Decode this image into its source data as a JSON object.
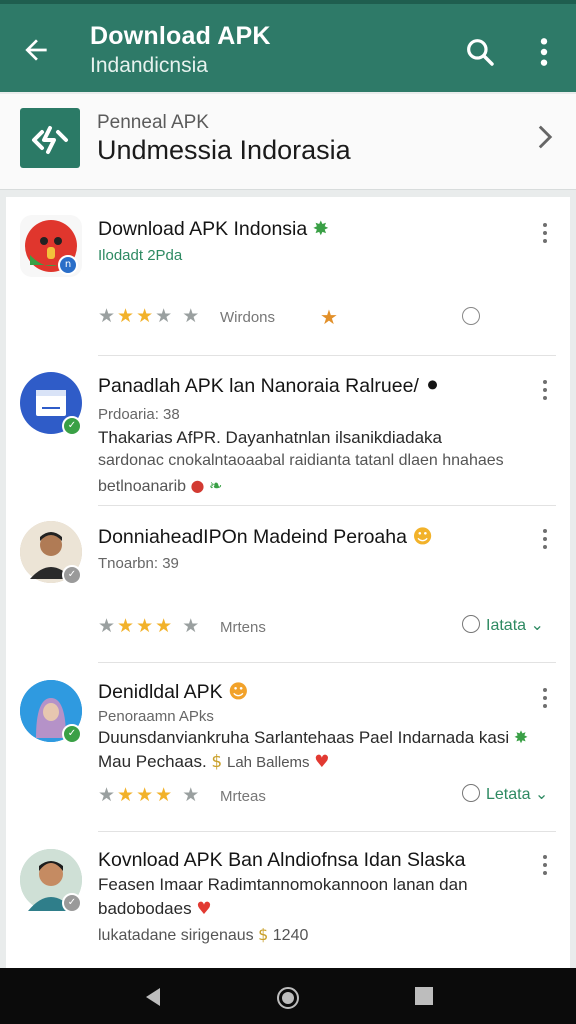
{
  "appbar": {
    "title": "Download APK",
    "subtitle": "Indandicnsia"
  },
  "header": {
    "label": "Penneal APK",
    "name": "Undmessia Indorasia"
  },
  "items": [
    {
      "title": "Download APK Indonsia",
      "meta": "Ilodadt 2Pda",
      "stars": 3,
      "rating_label": "Wirdons",
      "avatar_color": "#d23a32"
    },
    {
      "title": "Panadlah APK lan Nanoraia Ralruee/",
      "meta": "Prdoaria: 38",
      "desc1": "Thakarias AfPR. Dayanhatnlan ilsanikdiadaka",
      "desc2": "sardonac cnokalntaoaabal raidianta tatanl dlaen hnahaes",
      "desc3": "betlnoanarib",
      "avatar_color": "#2f5cc8"
    },
    {
      "title": "DonniaheadIPOn Madeind Peroaha",
      "meta": "Tnoarbn: 39",
      "stars": 4,
      "rating_label": "Mrtens",
      "action": "Iatata"
    },
    {
      "title": "Denidldal APK",
      "meta": "Penoraamn APks",
      "desc1": "Duunsdanviankruha Sarlantehaas Pael Indarnada kasi",
      "desc2": "Mau Pechaas.",
      "desc2b": "Lah Ballems",
      "stars": 4,
      "rating_label": "Mrteas",
      "action": "Letata"
    },
    {
      "title": "Kovnload APK Ban Alndiofnsa Idan Slaska",
      "desc1": "Feasen Imaar  Radimtannomokannoon lanan dan",
      "desc2": "badobodaes",
      "desc3": "lukatadane sirigenaus",
      "desc3_num": "1240"
    }
  ],
  "colors": {
    "appbar": "#2e7a68",
    "star": "#f2b22a",
    "action": "#2e8a62"
  },
  "icons": [
    "back-arrow-icon",
    "search-icon",
    "more-vert-icon",
    "chevron-right-icon",
    "nav-back-icon",
    "nav-home-icon",
    "nav-recents-icon"
  ]
}
